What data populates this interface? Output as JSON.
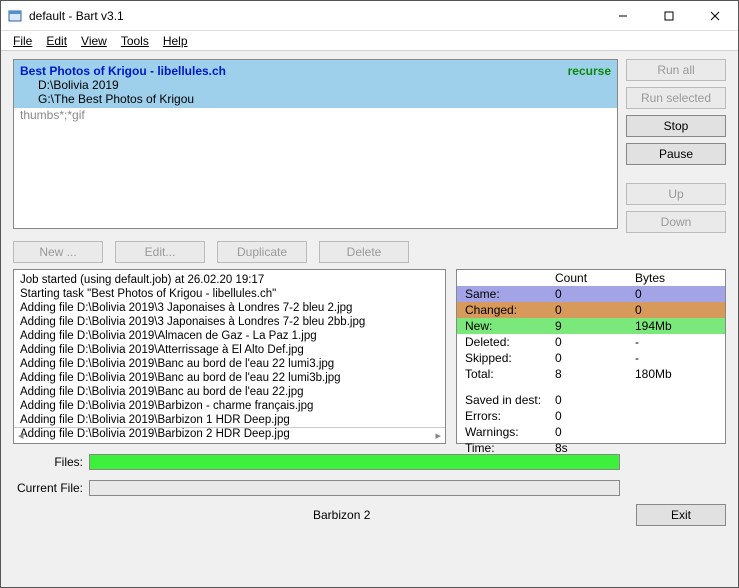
{
  "window": {
    "title": "default - Bart v3.1"
  },
  "menubar": [
    "File",
    "Edit",
    "View",
    "Tools",
    "Help"
  ],
  "task": {
    "title": "Best Photos of Krigou - libellules.ch",
    "recurse": "recurse",
    "path1": "D:\\Bolivia 2019",
    "path2": "G:\\The Best Photos of Krigou",
    "filter": "thumbs*;*gif"
  },
  "side_buttons": {
    "run_all": "Run all",
    "run_selected": "Run selected",
    "stop": "Stop",
    "pause": "Pause",
    "up": "Up",
    "down": "Down"
  },
  "task_buttons": {
    "new": "New ...",
    "edit": "Edit...",
    "duplicate": "Duplicate",
    "delete": "Delete"
  },
  "log": [
    "Job started (using default.job) at 26.02.20 19:17",
    "Starting task \"Best Photos of Krigou - libellules.ch\"",
    "Adding file D:\\Bolivia 2019\\3 Japonaises à Londres 7-2 bleu 2.jpg",
    "Adding file D:\\Bolivia 2019\\3 Japonaises à Londres 7-2 bleu 2bb.jpg",
    "Adding file D:\\Bolivia 2019\\Almacen de Gaz - La Paz 1.jpg",
    "Adding file D:\\Bolivia 2019\\Atterrissage à El Alto Def.jpg",
    "Adding file D:\\Bolivia 2019\\Banc au bord de l'eau 22 lumi3.jpg",
    "Adding file D:\\Bolivia 2019\\Banc au bord de l'eau 22 lumi3b.jpg",
    "Adding file D:\\Bolivia 2019\\Banc au bord de l'eau 22.jpg",
    "Adding file D:\\Bolivia 2019\\Barbizon - charme français.jpg",
    "Adding file D:\\Bolivia 2019\\Barbizon 1 HDR Deep.jpg",
    "Adding file D:\\Bolivia 2019\\Barbizon 2 HDR Deep.jpg"
  ],
  "stats": {
    "header": {
      "count": "Count",
      "bytes": "Bytes"
    },
    "rows": [
      {
        "label": "Same:",
        "count": "0",
        "bytes": "0",
        "cls": "row-same"
      },
      {
        "label": "Changed:",
        "count": "0",
        "bytes": "0",
        "cls": "row-changed"
      },
      {
        "label": "New:",
        "count": "9",
        "bytes": "194Mb",
        "cls": "row-new"
      },
      {
        "label": "Deleted:",
        "count": "0",
        "bytes": "-",
        "cls": ""
      },
      {
        "label": "Skipped:",
        "count": "0",
        "bytes": "-",
        "cls": ""
      },
      {
        "label": "Total:",
        "count": "8",
        "bytes": "180Mb",
        "cls": ""
      }
    ],
    "summary": [
      {
        "label": "Saved in dest:",
        "value": "0"
      },
      {
        "label": "Errors:",
        "value": "0"
      },
      {
        "label": "Warnings:",
        "value": "0"
      },
      {
        "label": "Time:",
        "value": "8s"
      }
    ]
  },
  "progress": {
    "files_label": "Files:",
    "current_label": "Current File:",
    "files_pct": 100,
    "current_pct": 0
  },
  "footer": {
    "current_file": "Barbizon 2",
    "exit": "Exit"
  }
}
